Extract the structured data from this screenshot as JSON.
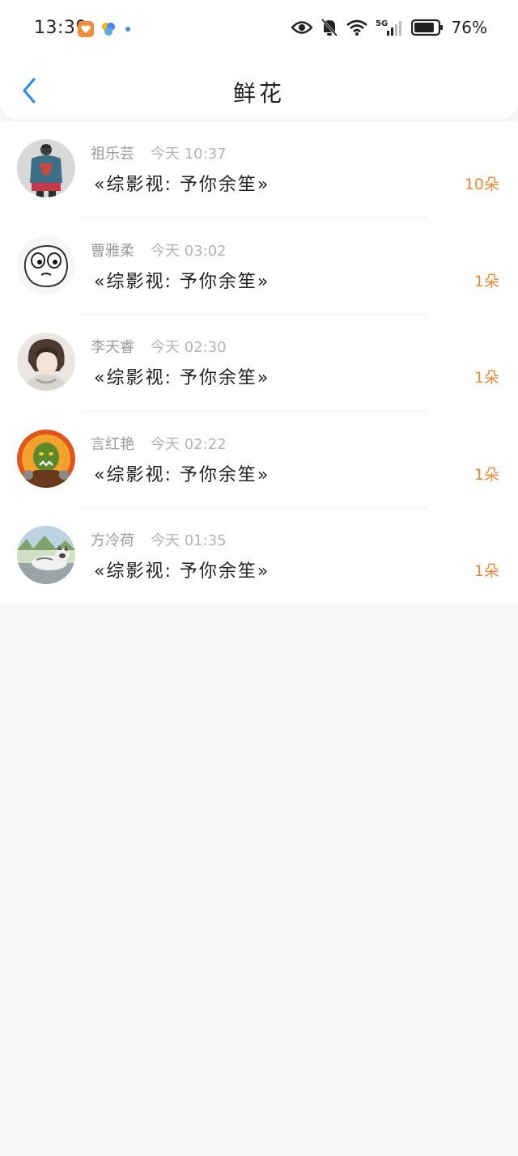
{
  "status_bar": {
    "time": "13:39",
    "network": "5G",
    "battery_percent": "76%",
    "icons": [
      "app-icon-orange",
      "pinwheel-icon",
      "dot-icon",
      "eye-icon",
      "bell-off-icon",
      "wifi-icon",
      "signal-icon",
      "battery-icon"
    ]
  },
  "header": {
    "title": "鲜花",
    "back_icon": "chevron-left-icon"
  },
  "list": [
    {
      "name": "祖乐芸",
      "time": "今天 10:37",
      "book": "«综影视: 予你余笙»",
      "count": "10朵",
      "avatar": "jacket-illustration"
    },
    {
      "name": "曹雅柔",
      "time": "今天 03:02",
      "book": "«综影视: 予你余笙»",
      "count": "1朵",
      "avatar": "cartoon-face"
    },
    {
      "name": "李天睿",
      "time": "今天 02:30",
      "book": "«综影视: 予你余笙»",
      "count": "1朵",
      "avatar": "anime-character"
    },
    {
      "name": "言红艳",
      "time": "今天 02:22",
      "book": "«综影视: 予你余笙»",
      "count": "1朵",
      "avatar": "orc-warrior"
    },
    {
      "name": "方冷荷",
      "time": "今天 01:35",
      "book": "«综影视: 予你余笙»",
      "count": "1朵",
      "avatar": "husky-dog"
    }
  ],
  "colors": {
    "accent": "#2f8fe6",
    "count": "#f0883a",
    "name": "#9a9a9a",
    "background": "#f8f7f8"
  }
}
